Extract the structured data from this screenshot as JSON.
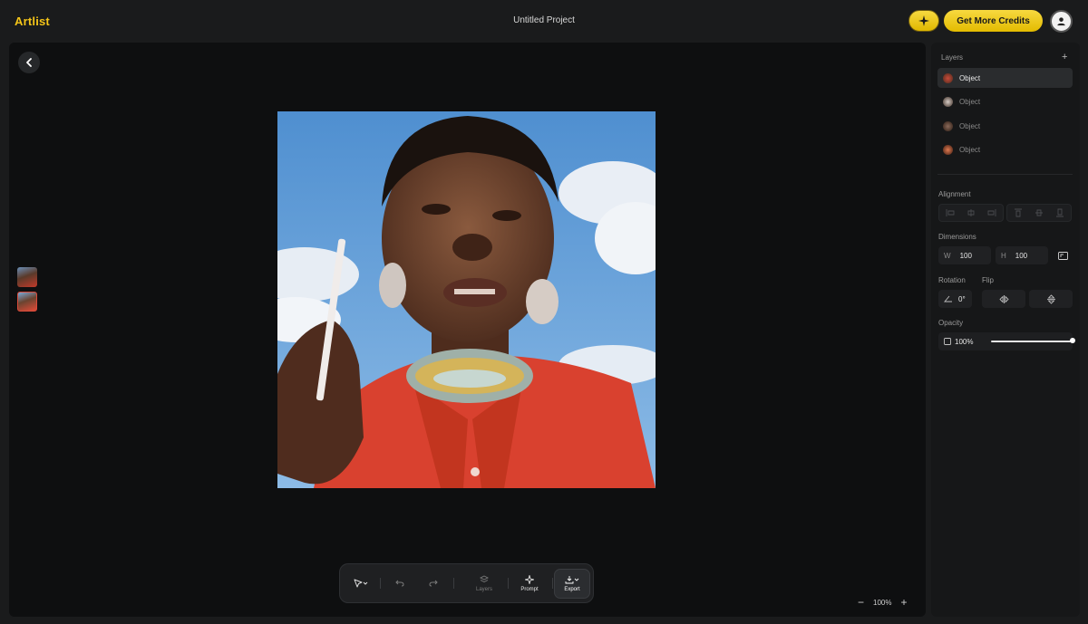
{
  "header": {
    "logo": "Artlist",
    "project_title": "Untitled Project",
    "credits_button": "Get More Credits"
  },
  "icons": {
    "spark": "sparkle-icon",
    "user": "user-icon",
    "back": "chevron-left-icon"
  },
  "layers": {
    "title": "Layers",
    "items": [
      {
        "label": "Object"
      },
      {
        "label": "Object"
      },
      {
        "label": "Object"
      },
      {
        "label": "Object"
      }
    ]
  },
  "alignment": {
    "title": "Alignment"
  },
  "dimensions": {
    "title": "Dimensions",
    "width_label": "W",
    "width_value": "100",
    "height_label": "H",
    "height_value": "100"
  },
  "rotation": {
    "title": "Rotation",
    "value": "0°"
  },
  "flip": {
    "title": "Flip"
  },
  "opacity": {
    "title": "Opacity",
    "value": "100%",
    "level": 1.0
  },
  "toolbar": {
    "layers_label": "Layers",
    "prompt_label": "Prompt",
    "export_label": "Export"
  },
  "zoom": {
    "value": "100%"
  },
  "colors": {
    "accent": "#f5c518",
    "background": "#1a1b1c",
    "canvas": "#0e0f10"
  }
}
